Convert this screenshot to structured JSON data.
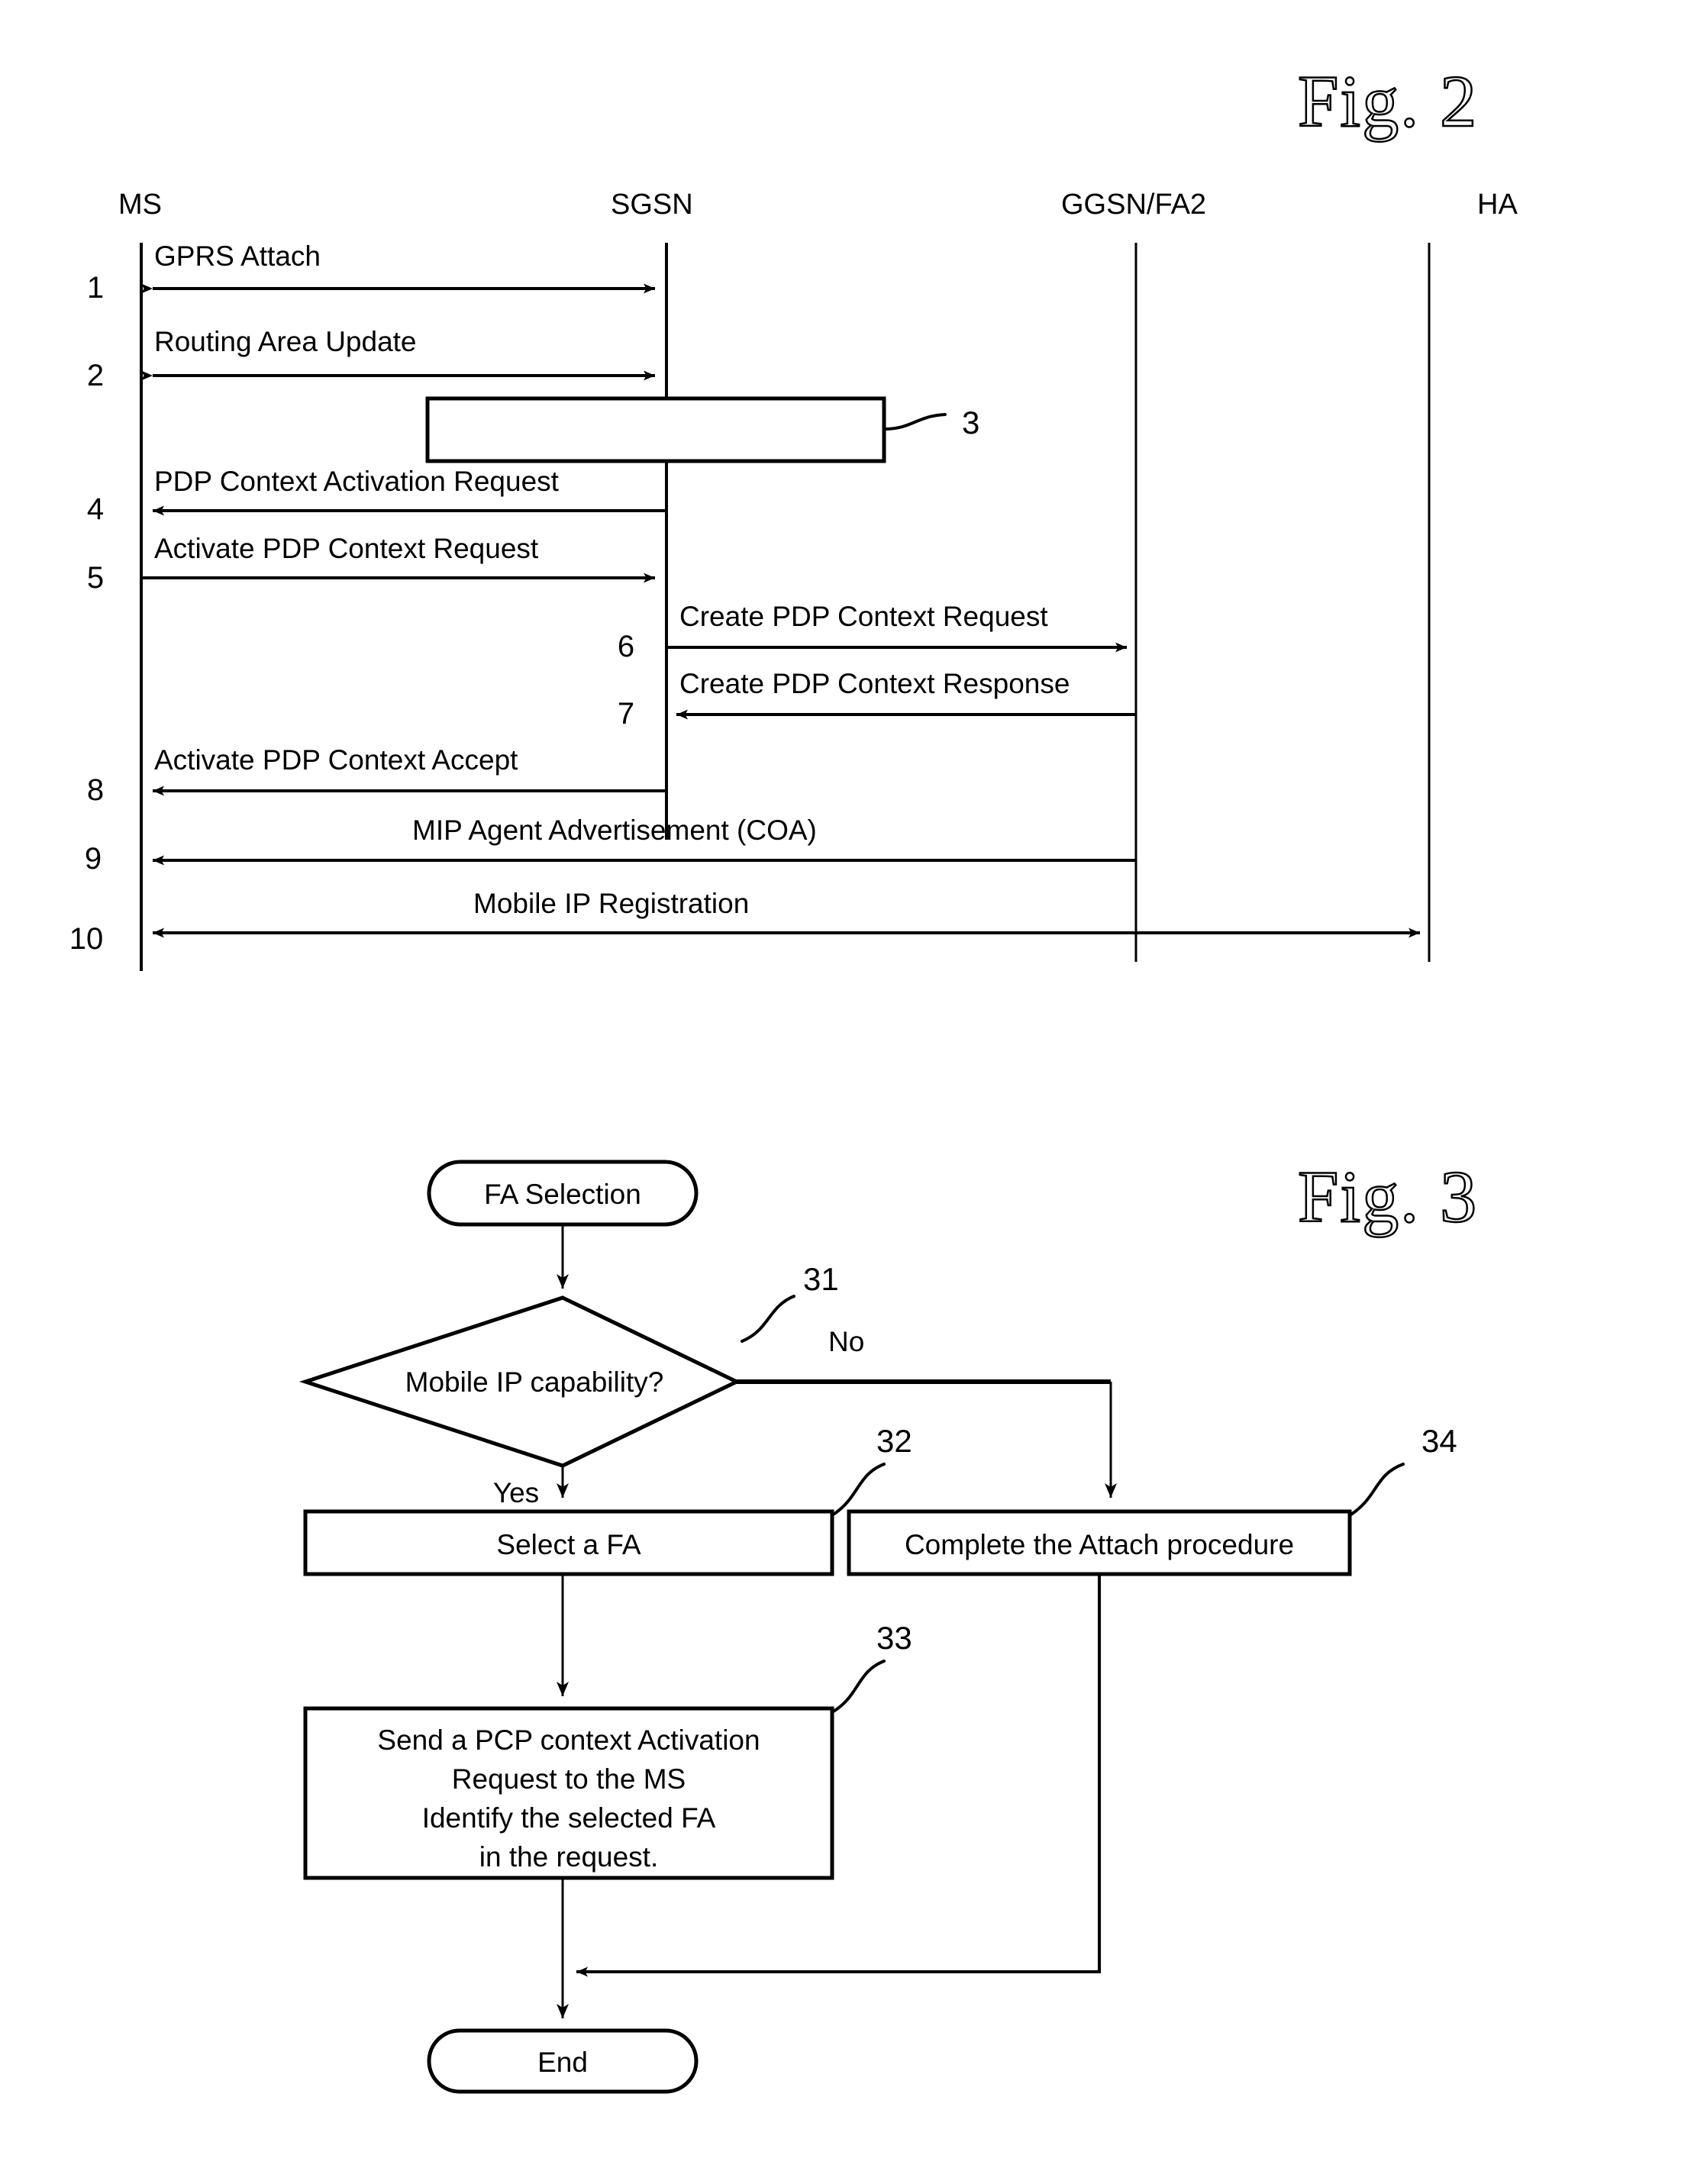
{
  "figures": [
    {
      "id": "fig2",
      "title": "Fig. 2",
      "type": "sequence-diagram",
      "lifelines": [
        {
          "name": "MS",
          "label": "MS"
        },
        {
          "name": "SGSN",
          "label": "SGSN"
        },
        {
          "name": "GGSN/FA2",
          "label": "GGSN/FA2"
        },
        {
          "name": "HA",
          "label": "HA"
        }
      ],
      "messages": [
        {
          "step": "1",
          "label": "GPRS Attach",
          "from": "SGSN",
          "to": "MS",
          "direction": "both"
        },
        {
          "step": "2",
          "label": "Routing Area Update",
          "from": "SGSN",
          "to": "MS",
          "direction": "both"
        },
        {
          "step": "4",
          "label": "PDP Context Activation Request",
          "from": "SGSN",
          "to": "MS",
          "direction": "left"
        },
        {
          "step": "5",
          "label": "Activate PDP Context Request",
          "from": "MS",
          "to": "SGSN",
          "direction": "right"
        },
        {
          "step": "6",
          "label": "Create PDP Context Request",
          "from": "SGSN",
          "to": "GGSN/FA2",
          "direction": "right"
        },
        {
          "step": "7",
          "label": "Create PDP Context Response",
          "from": "GGSN/FA2",
          "to": "SGSN",
          "direction": "left"
        },
        {
          "step": "8",
          "label": "Activate PDP Context Accept",
          "from": "SGSN",
          "to": "MS",
          "direction": "left"
        },
        {
          "step": "9",
          "label": "MIP Agent Advertisement (COA)",
          "from": "GGSN/FA2",
          "to": "MS",
          "direction": "left"
        },
        {
          "step": "10",
          "label": "Mobile IP Registration",
          "from": "MS",
          "to": "HA",
          "direction": "both"
        }
      ],
      "process_box": {
        "ref": "3",
        "label": ""
      }
    },
    {
      "id": "fig3",
      "title": "Fig. 3",
      "type": "flowchart",
      "nodes": [
        {
          "ref": "",
          "kind": "terminator",
          "label": "FA Selection"
        },
        {
          "ref": "31",
          "kind": "decision",
          "label": "Mobile IP capability?"
        },
        {
          "ref": "32",
          "kind": "process",
          "label": "Select a FA"
        },
        {
          "ref": "34",
          "kind": "process",
          "label": "Complete the Attach procedure"
        },
        {
          "ref": "33",
          "kind": "process",
          "label_lines": [
            "Send a PCP context Activation",
            "Request to the MS",
            "Identify the selected FA",
            "in the request."
          ]
        },
        {
          "ref": "",
          "kind": "terminator",
          "label": "End"
        }
      ],
      "branch_labels": {
        "yes": "Yes",
        "no": "No"
      }
    }
  ],
  "fig2": {
    "title": "Fig. 2",
    "headers": {
      "ms": "MS",
      "sgsn": "SGSN",
      "ggsn": "GGSN/FA2",
      "ha": "HA"
    },
    "steps": {
      "s1": "1",
      "s2": "2",
      "s4": "4",
      "s5": "5",
      "s6": "6",
      "s7": "7",
      "s8": "8",
      "s9": "9",
      "s10": "10"
    },
    "labels": {
      "m1": "GPRS Attach",
      "m2": "Routing Area Update",
      "m4": "PDP Context Activation Request",
      "m5": "Activate PDP Context Request",
      "m6": "Create PDP Context Request",
      "m7": "Create PDP Context Response",
      "m8": "Activate PDP Context Accept",
      "m9": "MIP Agent Advertisement (COA)",
      "m10": "Mobile IP Registration"
    },
    "refs": {
      "box3": "3"
    }
  },
  "fig3": {
    "title": "Fig. 3",
    "start": "FA Selection",
    "decision": "Mobile IP capability?",
    "yes": "Yes",
    "no": "No",
    "select_fa": "Select a FA",
    "complete_attach": "Complete the Attach procedure",
    "send_pcp": {
      "l1": "Send a PCP context Activation",
      "l2": "Request to the MS",
      "l3": "Identify the selected FA",
      "l4": "in the request."
    },
    "end": "End",
    "refs": {
      "r31": "31",
      "r32": "32",
      "r33": "33",
      "r34": "34"
    }
  }
}
